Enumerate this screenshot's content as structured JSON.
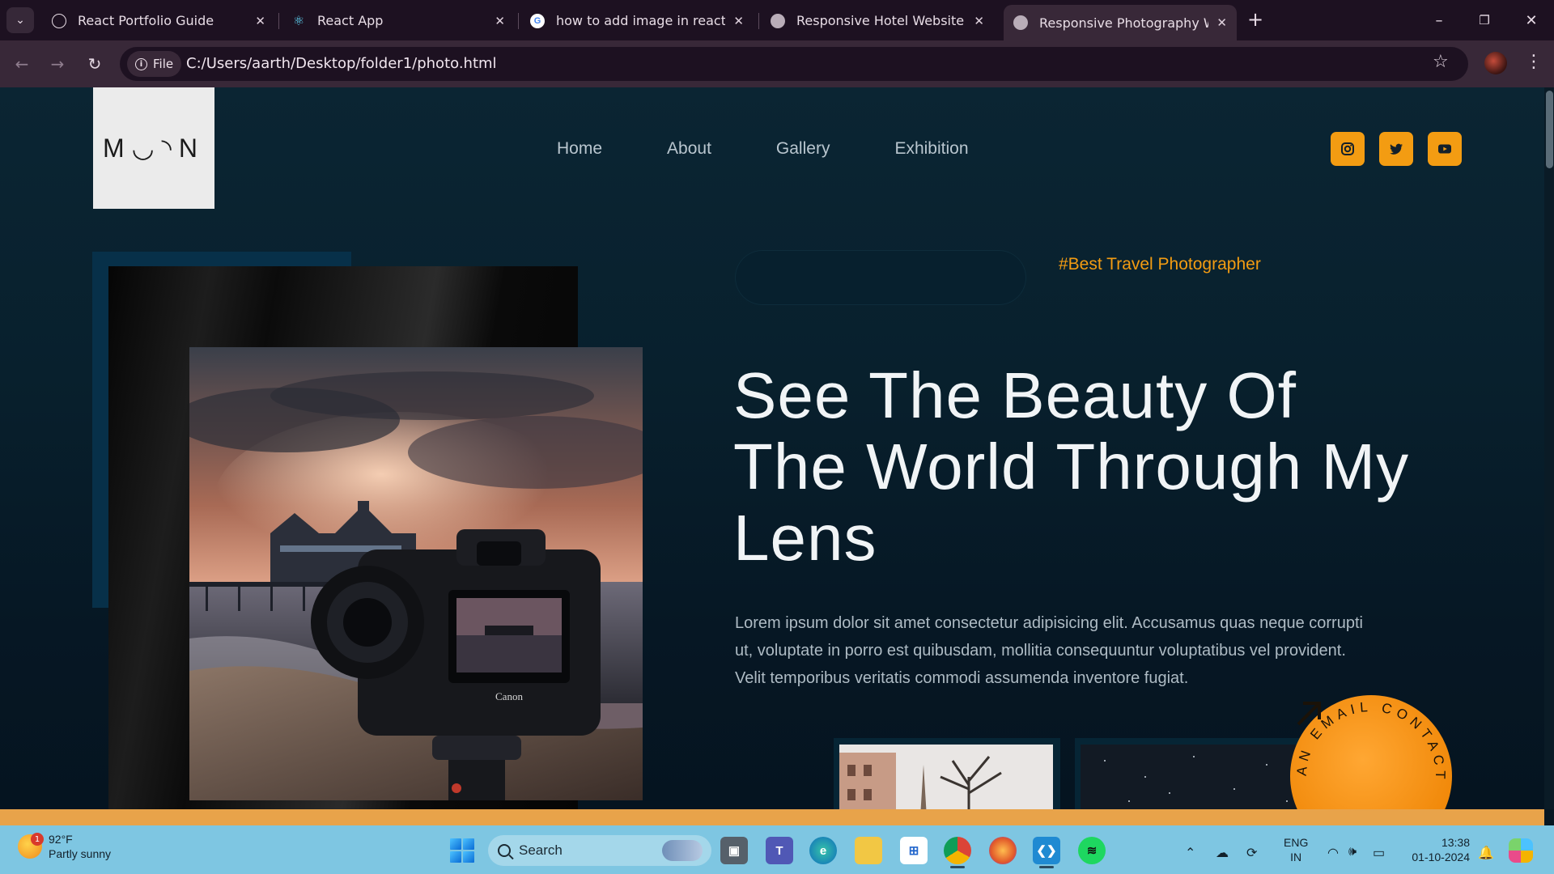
{
  "browser": {
    "tabs": [
      {
        "title": "React Portfolio Guide",
        "favicon": "openai-icon",
        "active": false
      },
      {
        "title": "React App",
        "favicon": "react-icon",
        "active": false
      },
      {
        "title": "how to add image in react js - G",
        "favicon": "google-icon",
        "active": false
      },
      {
        "title": "Responsive Hotel Website",
        "favicon": "globe-icon",
        "active": false
      },
      {
        "title": "Responsive Photography Websi",
        "favicon": "globe-icon",
        "active": true
      }
    ],
    "address": {
      "chip_label": "File",
      "url": "C:/Users/aarth/Desktop/folder1/photo.html"
    }
  },
  "page": {
    "logo": "M◡◝N",
    "nav": [
      "Home",
      "About",
      "Gallery",
      "Exhibition"
    ],
    "social": [
      "instagram-icon",
      "twitter-icon",
      "youtube-icon"
    ],
    "tagline": "#Best Travel Photographer",
    "headline": "See The Beauty Of The World Through My Lens",
    "body": "Lorem ipsum dolor sit amet consectetur adipisicing elit. Accusamus quas neque corrupti ut, voluptate in porro est quibusdam, mollitia consequuntur voluptatibus vel provident. Velit temporibus veritatis commodi assumenda inventore fugiat.",
    "badge_text": "AN EMAIL CONTACT",
    "camera_brand": "Canon",
    "accent_color": "#f39c12"
  },
  "taskbar": {
    "weather_temp": "92°F",
    "weather_desc": "Partly sunny",
    "weather_badge": "1",
    "search_placeholder": "Search",
    "lang_line1": "ENG",
    "lang_line2": "IN",
    "time": "13:38",
    "date": "01-10-2024"
  }
}
